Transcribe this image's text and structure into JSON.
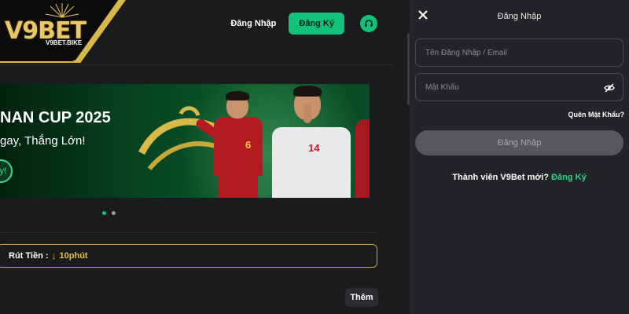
{
  "brand": {
    "logo_text": "V9BET",
    "logo_domain": "V9BET.BIKE"
  },
  "header": {
    "login_label": "Đăng Nhập",
    "register_label": "Đăng Ký",
    "support_icon": "headset-icon"
  },
  "banner": {
    "title": "NAN CUP 2025",
    "subtitle": "gay, Thắng Lớn!",
    "cta_label": "y!",
    "player_numbers": [
      "6",
      "14"
    ],
    "slide_count": 2,
    "active_slide": 1
  },
  "withdraw": {
    "label": "Rút Tiền :",
    "time": "10phút"
  },
  "more_label": "Thêm",
  "login_panel": {
    "title": "Đăng Nhập",
    "username_placeholder": "Tên Đăng Nhập / Email",
    "password_placeholder": "Mật Khẩu",
    "forgot_label": "Quên Mật Khẩu?",
    "submit_label": "Đăng Nhập",
    "new_member_text": "Thành viên V9Bet mới?",
    "register_link": "Đăng Ký"
  },
  "colors": {
    "accent": "#11c27c",
    "gold": "#e8c04a",
    "panel_bg": "#232427",
    "page_bg": "#1a1b1d"
  }
}
